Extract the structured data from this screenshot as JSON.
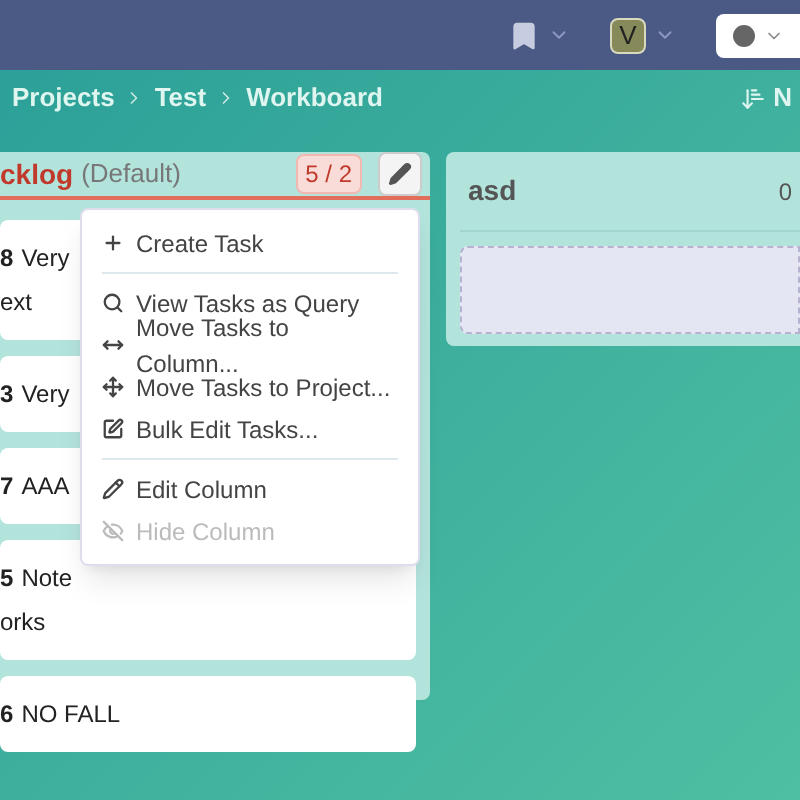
{
  "top_bar": {
    "avatar_letter": "V"
  },
  "breadcrumb": {
    "items": [
      "Projects",
      "Test",
      "Workboard"
    ],
    "action_label": "N"
  },
  "columns": [
    {
      "title": "cklog",
      "subtitle": "(Default)",
      "count": "5 / 2",
      "over_limit": true,
      "cards": [
        {
          "id": "8",
          "lines": [
            "Very",
            "ext"
          ]
        },
        {
          "id": "3",
          "lines": [
            "Very"
          ]
        },
        {
          "id": "7",
          "lines": [
            "AAA"
          ]
        },
        {
          "id": "5",
          "lines": [
            "Note",
            "orks"
          ]
        },
        {
          "id": "6",
          "lines": [
            "NO FALL"
          ]
        }
      ]
    },
    {
      "title": "asd",
      "count": "0",
      "over_limit": false
    }
  ],
  "column_menu": {
    "sections": [
      [
        {
          "label": "Create Task",
          "disabled": false
        }
      ],
      [
        {
          "label": "View Tasks as Query",
          "disabled": false
        },
        {
          "label": "Move Tasks to Column...",
          "disabled": false
        },
        {
          "label": "Move Tasks to Project...",
          "disabled": false
        },
        {
          "label": "Bulk Edit Tasks...",
          "disabled": false
        }
      ],
      [
        {
          "label": "Edit Column",
          "disabled": false
        },
        {
          "label": "Hide Column",
          "disabled": true
        }
      ]
    ]
  }
}
